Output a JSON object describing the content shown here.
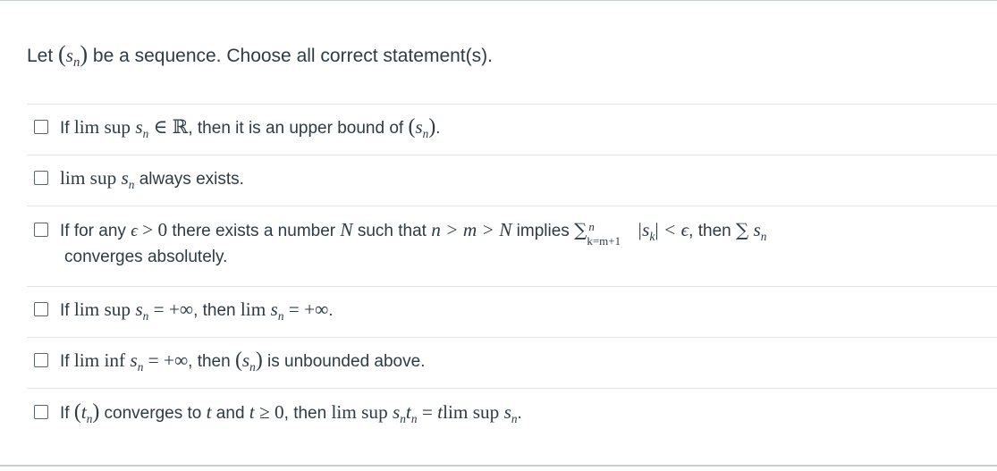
{
  "question": {
    "prefix": "Let ",
    "seq": "s",
    "seq_sub": "n",
    "suffix": " be a sequence. Choose all correct statement(s)."
  },
  "options": [
    {
      "t1": "If ",
      "limsup": "lim sup",
      "s": "s",
      "n": "n",
      "in": " ∈ ℝ",
      "t2": ", then it is an upper bound of ",
      "t3": "."
    },
    {
      "limsup": "lim sup",
      "s": "s",
      "n": "n",
      "t1": " always exists."
    },
    {
      "t1": "If for any ",
      "eps": "ϵ",
      "gt0": " > 0",
      "t2": " there exists a number ",
      "N": "N",
      "t3": " such that ",
      "rel": "n > m > N",
      "t4": " implies ",
      "sum_up": "n",
      "sum_dn": "k=m+1",
      "abs": "|s",
      "abs_sub": "k",
      "abs_end": "|",
      "lt": " < ϵ",
      "t5": ", then ",
      "sum2": "∑",
      "s": "s",
      "n": "n",
      "line2": "converges absolutely."
    },
    {
      "t1": "If ",
      "limsup": "lim sup",
      "s": "s",
      "n": "n",
      "eq": " = +∞",
      "t2": ", then ",
      "lim": "lim",
      "eq2": " = +∞",
      "t3": "."
    },
    {
      "t1": "If ",
      "liminf": "lim inf",
      "s": "s",
      "n": "n",
      "eq": " = +∞",
      "t2": ", then ",
      "t3": " is unbounded above."
    },
    {
      "t1": "If ",
      "tseq": "t",
      "n": "n",
      "t2": " converges to ",
      "t": "t",
      "t3": " and ",
      "ge": " ≥ 0",
      "t4": ", then ",
      "limsup": "lim sup",
      "s": "s",
      "eq": " = ",
      "t5": "."
    }
  ]
}
